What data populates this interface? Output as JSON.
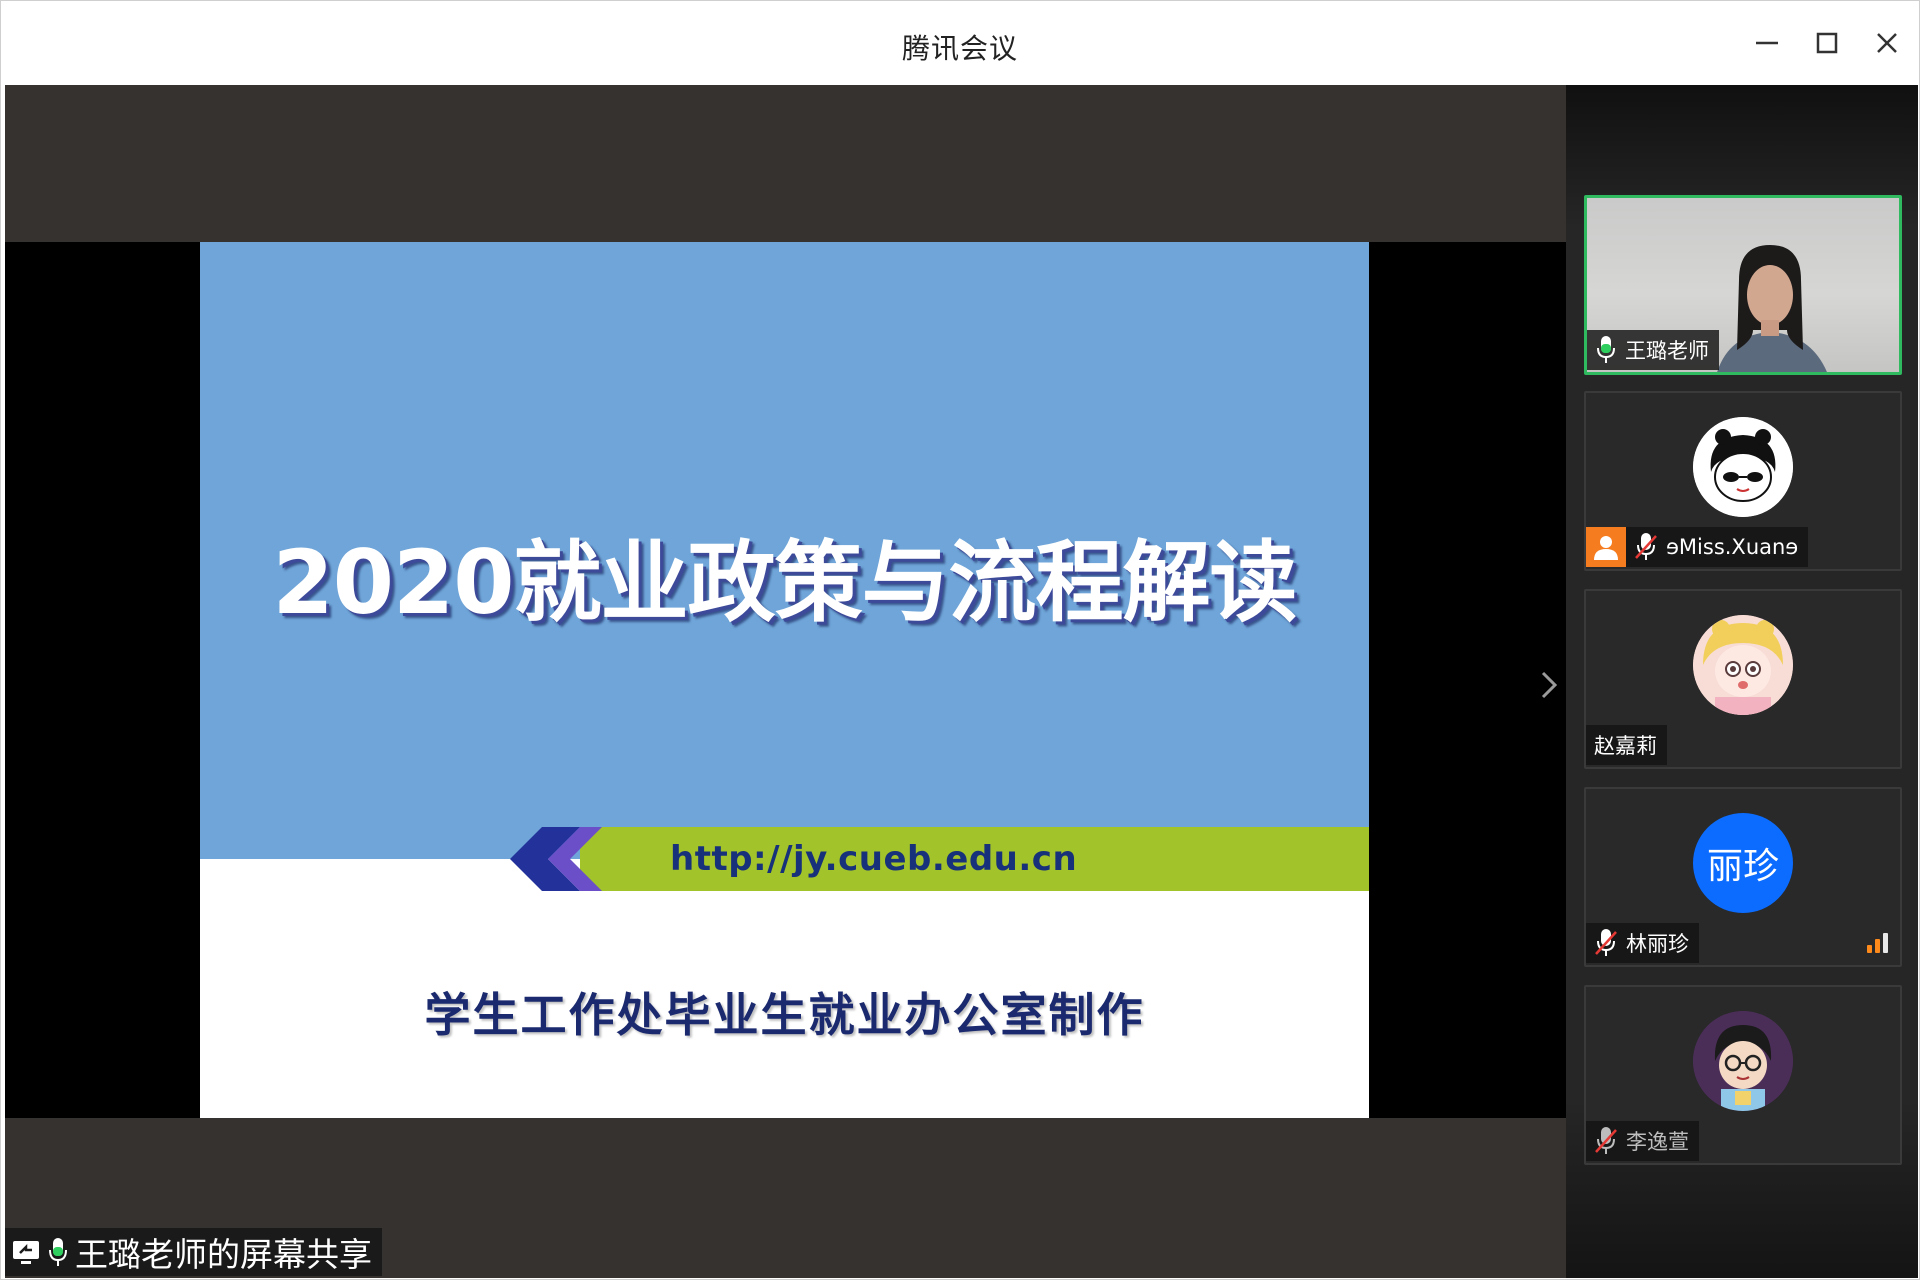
{
  "window": {
    "title": "腾讯会议",
    "controls": [
      "minimize-icon",
      "maximize-icon",
      "close-icon"
    ]
  },
  "slide": {
    "title": "2020就业政策与流程解读",
    "url": "http://jy.cueb.edu.cn",
    "subtitle": "学生工作处毕业生就业办公室制作",
    "colors": {
      "top": "#6fa5d8",
      "band": "#a3c32a",
      "chevron": "#23329a",
      "text": "#17317a"
    }
  },
  "share_label": {
    "text": "王璐老师的屏幕共享",
    "icons": [
      "screen-share-icon",
      "mic-icon"
    ]
  },
  "participants": [
    {
      "name": "王璐老师",
      "mic": "on",
      "video": true,
      "active": true
    },
    {
      "name": "ɘMiss.Xuanɘ",
      "mic": "muted",
      "host": true,
      "avatar": "cartoon-girl"
    },
    {
      "name": "赵嘉莉",
      "mic": "none",
      "avatar": "anime-girl"
    },
    {
      "name": "林丽珍",
      "mic": "muted",
      "avatar_text": "丽珍",
      "signal": "weak"
    },
    {
      "name": "李逸萱",
      "mic": "muted",
      "avatar": "cartoon-boy",
      "dim": true
    }
  ]
}
